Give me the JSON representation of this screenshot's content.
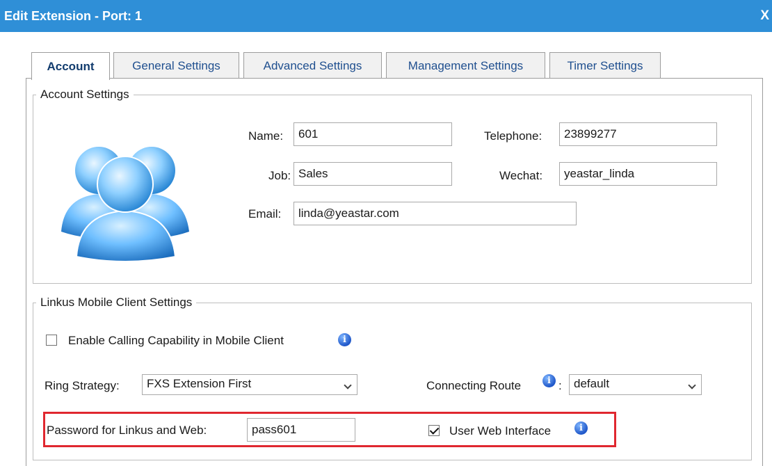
{
  "window": {
    "title": "Edit Extension - Port: 1",
    "close_label": "X"
  },
  "tabs": [
    {
      "label": "Account",
      "active": true
    },
    {
      "label": "General Settings",
      "active": false
    },
    {
      "label": "Advanced Settings",
      "active": false
    },
    {
      "label": "Management Settings",
      "active": false
    },
    {
      "label": "Timer Settings",
      "active": false
    }
  ],
  "account_settings": {
    "legend": "Account Settings",
    "name_label": "Name:",
    "name_value": "601",
    "telephone_label": "Telephone:",
    "telephone_value": "23899277",
    "job_label": "Job:",
    "job_value": "Sales",
    "wechat_label": "Wechat:",
    "wechat_value": "yeastar_linda",
    "email_label": "Email:",
    "email_value": "linda@yeastar.com"
  },
  "linkus_settings": {
    "legend": "Linkus Mobile Client Settings",
    "enable_calling_label": "Enable Calling Capability in Mobile Client",
    "enable_calling_checked": false,
    "ring_strategy_label": "Ring Strategy:",
    "ring_strategy_value": "FXS Extension First",
    "connecting_route_label": "Connecting Route",
    "connecting_route_colon": ":",
    "connecting_route_value": "default",
    "password_label": "Password for Linkus and Web:",
    "password_value": "pass601",
    "user_web_interface_label": "User Web Interface",
    "user_web_interface_checked": true
  },
  "icons": {
    "info": "info-icon",
    "avatar": "users-group-icon",
    "dropdown": "chevron-down-icon"
  },
  "colors": {
    "titlebar": "#2f8fd7",
    "highlight": "#e0272f",
    "tab_text": "#1f4f8f",
    "info_icon": "#1f57c9"
  }
}
